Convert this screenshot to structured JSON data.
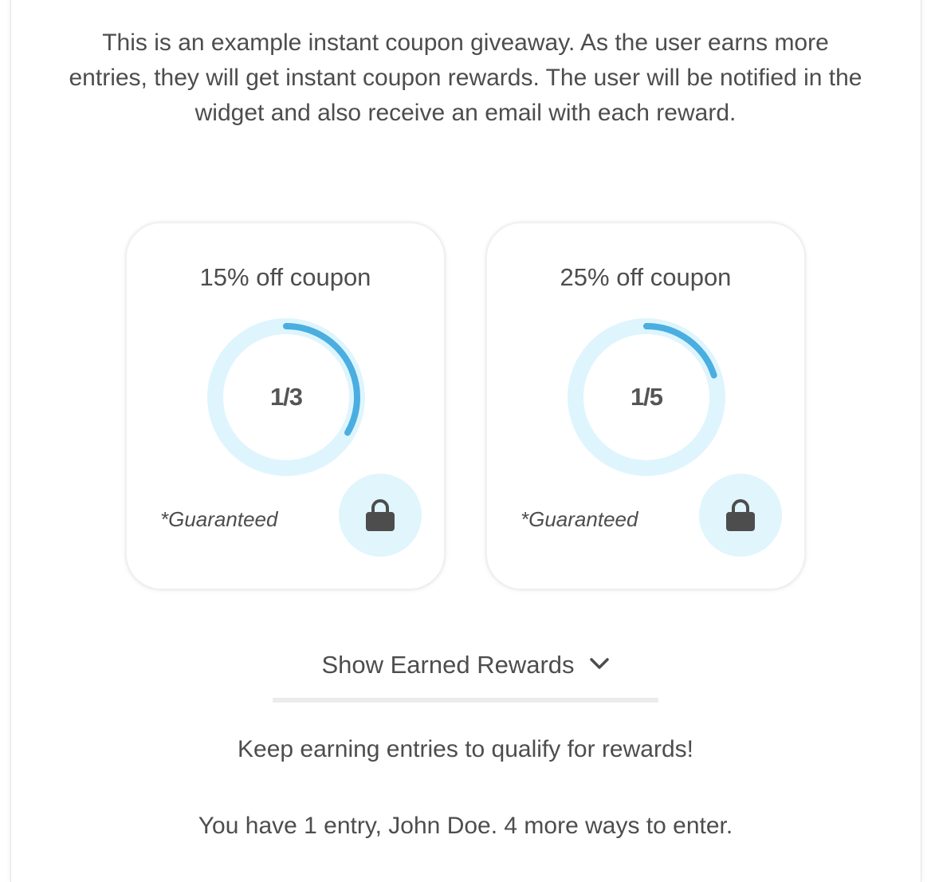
{
  "intro": {
    "text": "This is an example instant coupon giveaway. As the user earns more entries, they will get instant coupon rewards. The user will be notified in the widget and also receive an email with each reward."
  },
  "rewards": [
    {
      "title": "15% off coupon",
      "progress_label": "1/3",
      "progress": 0.3333,
      "tag": "*Guaranteed",
      "icon": "lock-icon"
    },
    {
      "title": "25% off coupon",
      "progress_label": "1/5",
      "progress": 0.2,
      "tag": "*Guaranteed",
      "icon": "lock-icon"
    }
  ],
  "toggle": {
    "label": "Show Earned Rewards",
    "icon": "chevron-down-icon"
  },
  "status": {
    "keep_earning": "Keep earning entries to qualify for rewards!",
    "entries": "You have 1 entry, John Doe. 4 more ways to enter."
  },
  "colors": {
    "ring_track": "#dff5fd",
    "ring_progress": "#4aaee0",
    "lock_bg": "#e0f5fc",
    "lock_icon": "#4d4d4d",
    "text": "#4d4d4d"
  }
}
